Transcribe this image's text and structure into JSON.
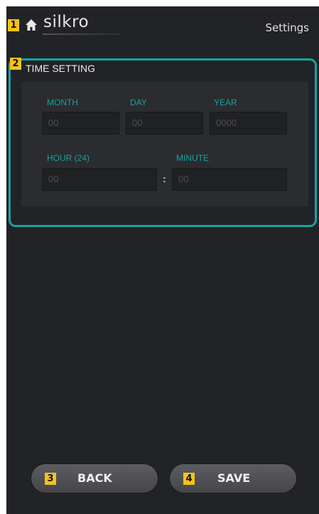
{
  "header": {
    "logo_text": "silkro",
    "title": "Settings"
  },
  "time_setting": {
    "title": "TIME SETTING",
    "month": {
      "label": "MONTH",
      "placeholder": "00"
    },
    "day": {
      "label": "DAY",
      "placeholder": "00"
    },
    "year": {
      "label": "YEAR",
      "placeholder": "0000"
    },
    "hour": {
      "label": "HOUR (24)",
      "placeholder": "00"
    },
    "minute": {
      "label": "MINUTE",
      "placeholder": "00"
    },
    "separator": ":"
  },
  "buttons": {
    "back_label": "BACK",
    "save_label": "SAVE"
  },
  "annotations": [
    "1",
    "2",
    "3",
    "4"
  ],
  "colors": {
    "accent": "#18a3a2",
    "badge": "#f5c21b",
    "background": "#222326"
  }
}
